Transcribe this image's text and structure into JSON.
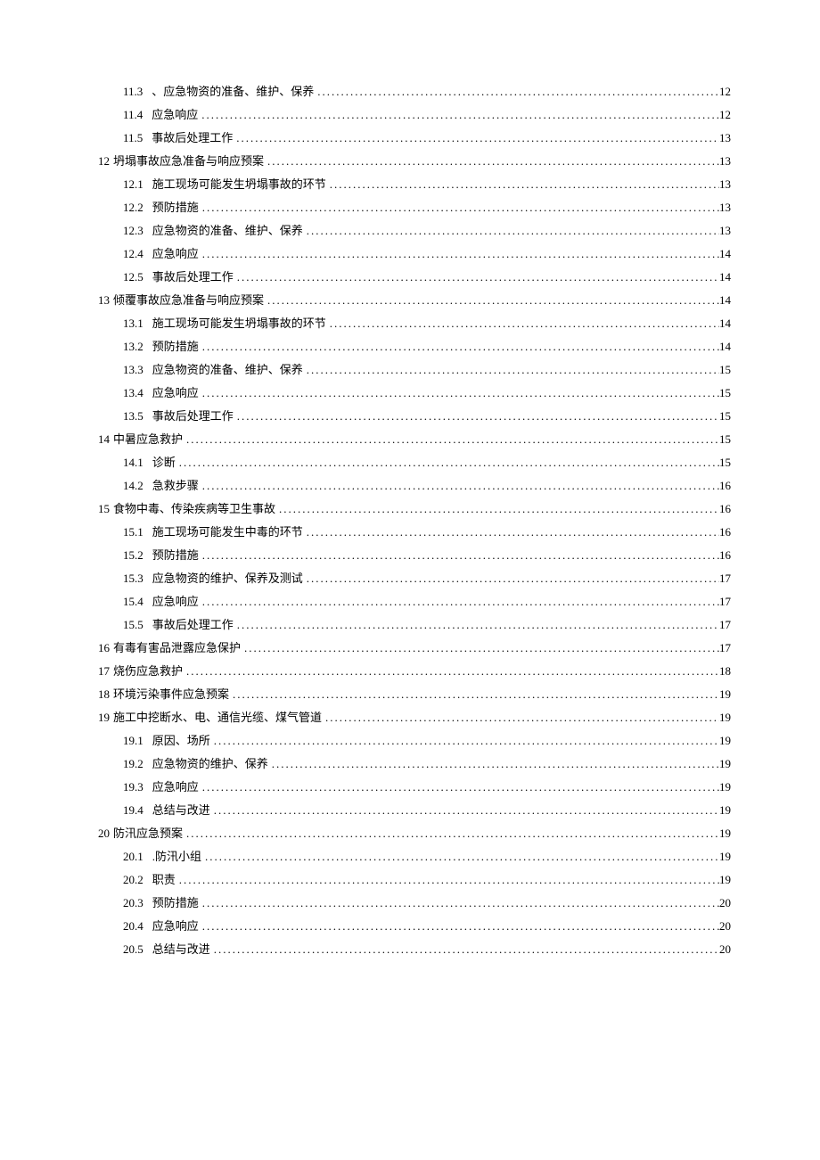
{
  "toc": [
    {
      "level": 2,
      "num": "11.3",
      "title": "、应急物资的准备、维护、保养",
      "page": "12"
    },
    {
      "level": 2,
      "num": "11.4",
      "title": "应急响应",
      "page": "12"
    },
    {
      "level": 2,
      "num": "11.5",
      "title": "事故后处理工作",
      "page": "13"
    },
    {
      "level": 1,
      "num": "12",
      "title": "坍塌事故应急准备与响应预案",
      "page": "13"
    },
    {
      "level": 2,
      "num": "12.1",
      "title": "施工现场可能发生坍塌事故的环节",
      "page": "13"
    },
    {
      "level": 2,
      "num": "12.2",
      "title": "预防措施",
      "page": "13"
    },
    {
      "level": 2,
      "num": "12.3",
      "title": "应急物资的准备、维护、保养",
      "page": "13"
    },
    {
      "level": 2,
      "num": "12.4",
      "title": "应急响应",
      "page": "14"
    },
    {
      "level": 2,
      "num": "12.5",
      "title": "事故后处理工作",
      "page": "14"
    },
    {
      "level": 1,
      "num": "13",
      "title": "倾覆事故应急准备与响应预案",
      "page": "14"
    },
    {
      "level": 2,
      "num": "13.1",
      "title": "施工现场可能发生坍塌事故的环节",
      "page": "14"
    },
    {
      "level": 2,
      "num": "13.2",
      "title": "预防措施",
      "page": "14"
    },
    {
      "level": 2,
      "num": "13.3",
      "title": "应急物资的准备、维护、保养",
      "page": "15"
    },
    {
      "level": 2,
      "num": "13.4",
      "title": "应急响应",
      "page": "15"
    },
    {
      "level": 2,
      "num": "13.5",
      "title": "事故后处理工作",
      "page": "15"
    },
    {
      "level": 1,
      "num": "14",
      "title": "中暑应急救护",
      "page": "15"
    },
    {
      "level": 2,
      "num": "14.1",
      "title": "诊断",
      "page": "15"
    },
    {
      "level": 2,
      "num": "14.2",
      "title": "急救步骤",
      "page": "16"
    },
    {
      "level": 1,
      "num": "15",
      "title": "食物中毒、传染疾病等卫生事故",
      "page": "16"
    },
    {
      "level": 2,
      "num": "15.1",
      "title": "施工现场可能发生中毒的环节",
      "page": "16"
    },
    {
      "level": 2,
      "num": "15.2",
      "title": "预防措施",
      "page": "16"
    },
    {
      "level": 2,
      "num": "15.3",
      "title": "应急物资的维护、保养及测试",
      "page": "17"
    },
    {
      "level": 2,
      "num": "15.4",
      "title": "应急响应",
      "page": "17"
    },
    {
      "level": 2,
      "num": "15.5",
      "title": "事故后处理工作",
      "page": "17"
    },
    {
      "level": 1,
      "num": "16",
      "title": "有毒有害品泄露应急保护",
      "page": "17"
    },
    {
      "level": 1,
      "num": "17",
      "title": "烧伤应急救护",
      "page": "18"
    },
    {
      "level": 1,
      "num": "18",
      "title": "环境污染事件应急预案",
      "page": "19"
    },
    {
      "level": 1,
      "num": "19",
      "title": "施工中挖断水、电、通信光缆、煤气管道",
      "page": "19"
    },
    {
      "level": 2,
      "num": "19.1",
      "title": "原因、场所",
      "page": "19"
    },
    {
      "level": 2,
      "num": "19.2",
      "title": "应急物资的维护、保养",
      "page": "19"
    },
    {
      "level": 2,
      "num": "19.3",
      "title": "应急响应",
      "page": "19"
    },
    {
      "level": 2,
      "num": "19.4",
      "title": "总结与改进",
      "page": "19"
    },
    {
      "level": 1,
      "num": "20",
      "title": "防汛应急预案",
      "page": "19"
    },
    {
      "level": 2,
      "num": "20.1",
      "title": ".防汛小组",
      "page": "19"
    },
    {
      "level": 2,
      "num": "20.2",
      "title": "职责",
      "page": "19"
    },
    {
      "level": 2,
      "num": "20.3",
      "title": "预防措施",
      "page": "20"
    },
    {
      "level": 2,
      "num": "20.4",
      "title": "应急响应",
      "page": "20"
    },
    {
      "level": 2,
      "num": "20.5",
      "title": "总结与改进",
      "page": "20"
    }
  ]
}
